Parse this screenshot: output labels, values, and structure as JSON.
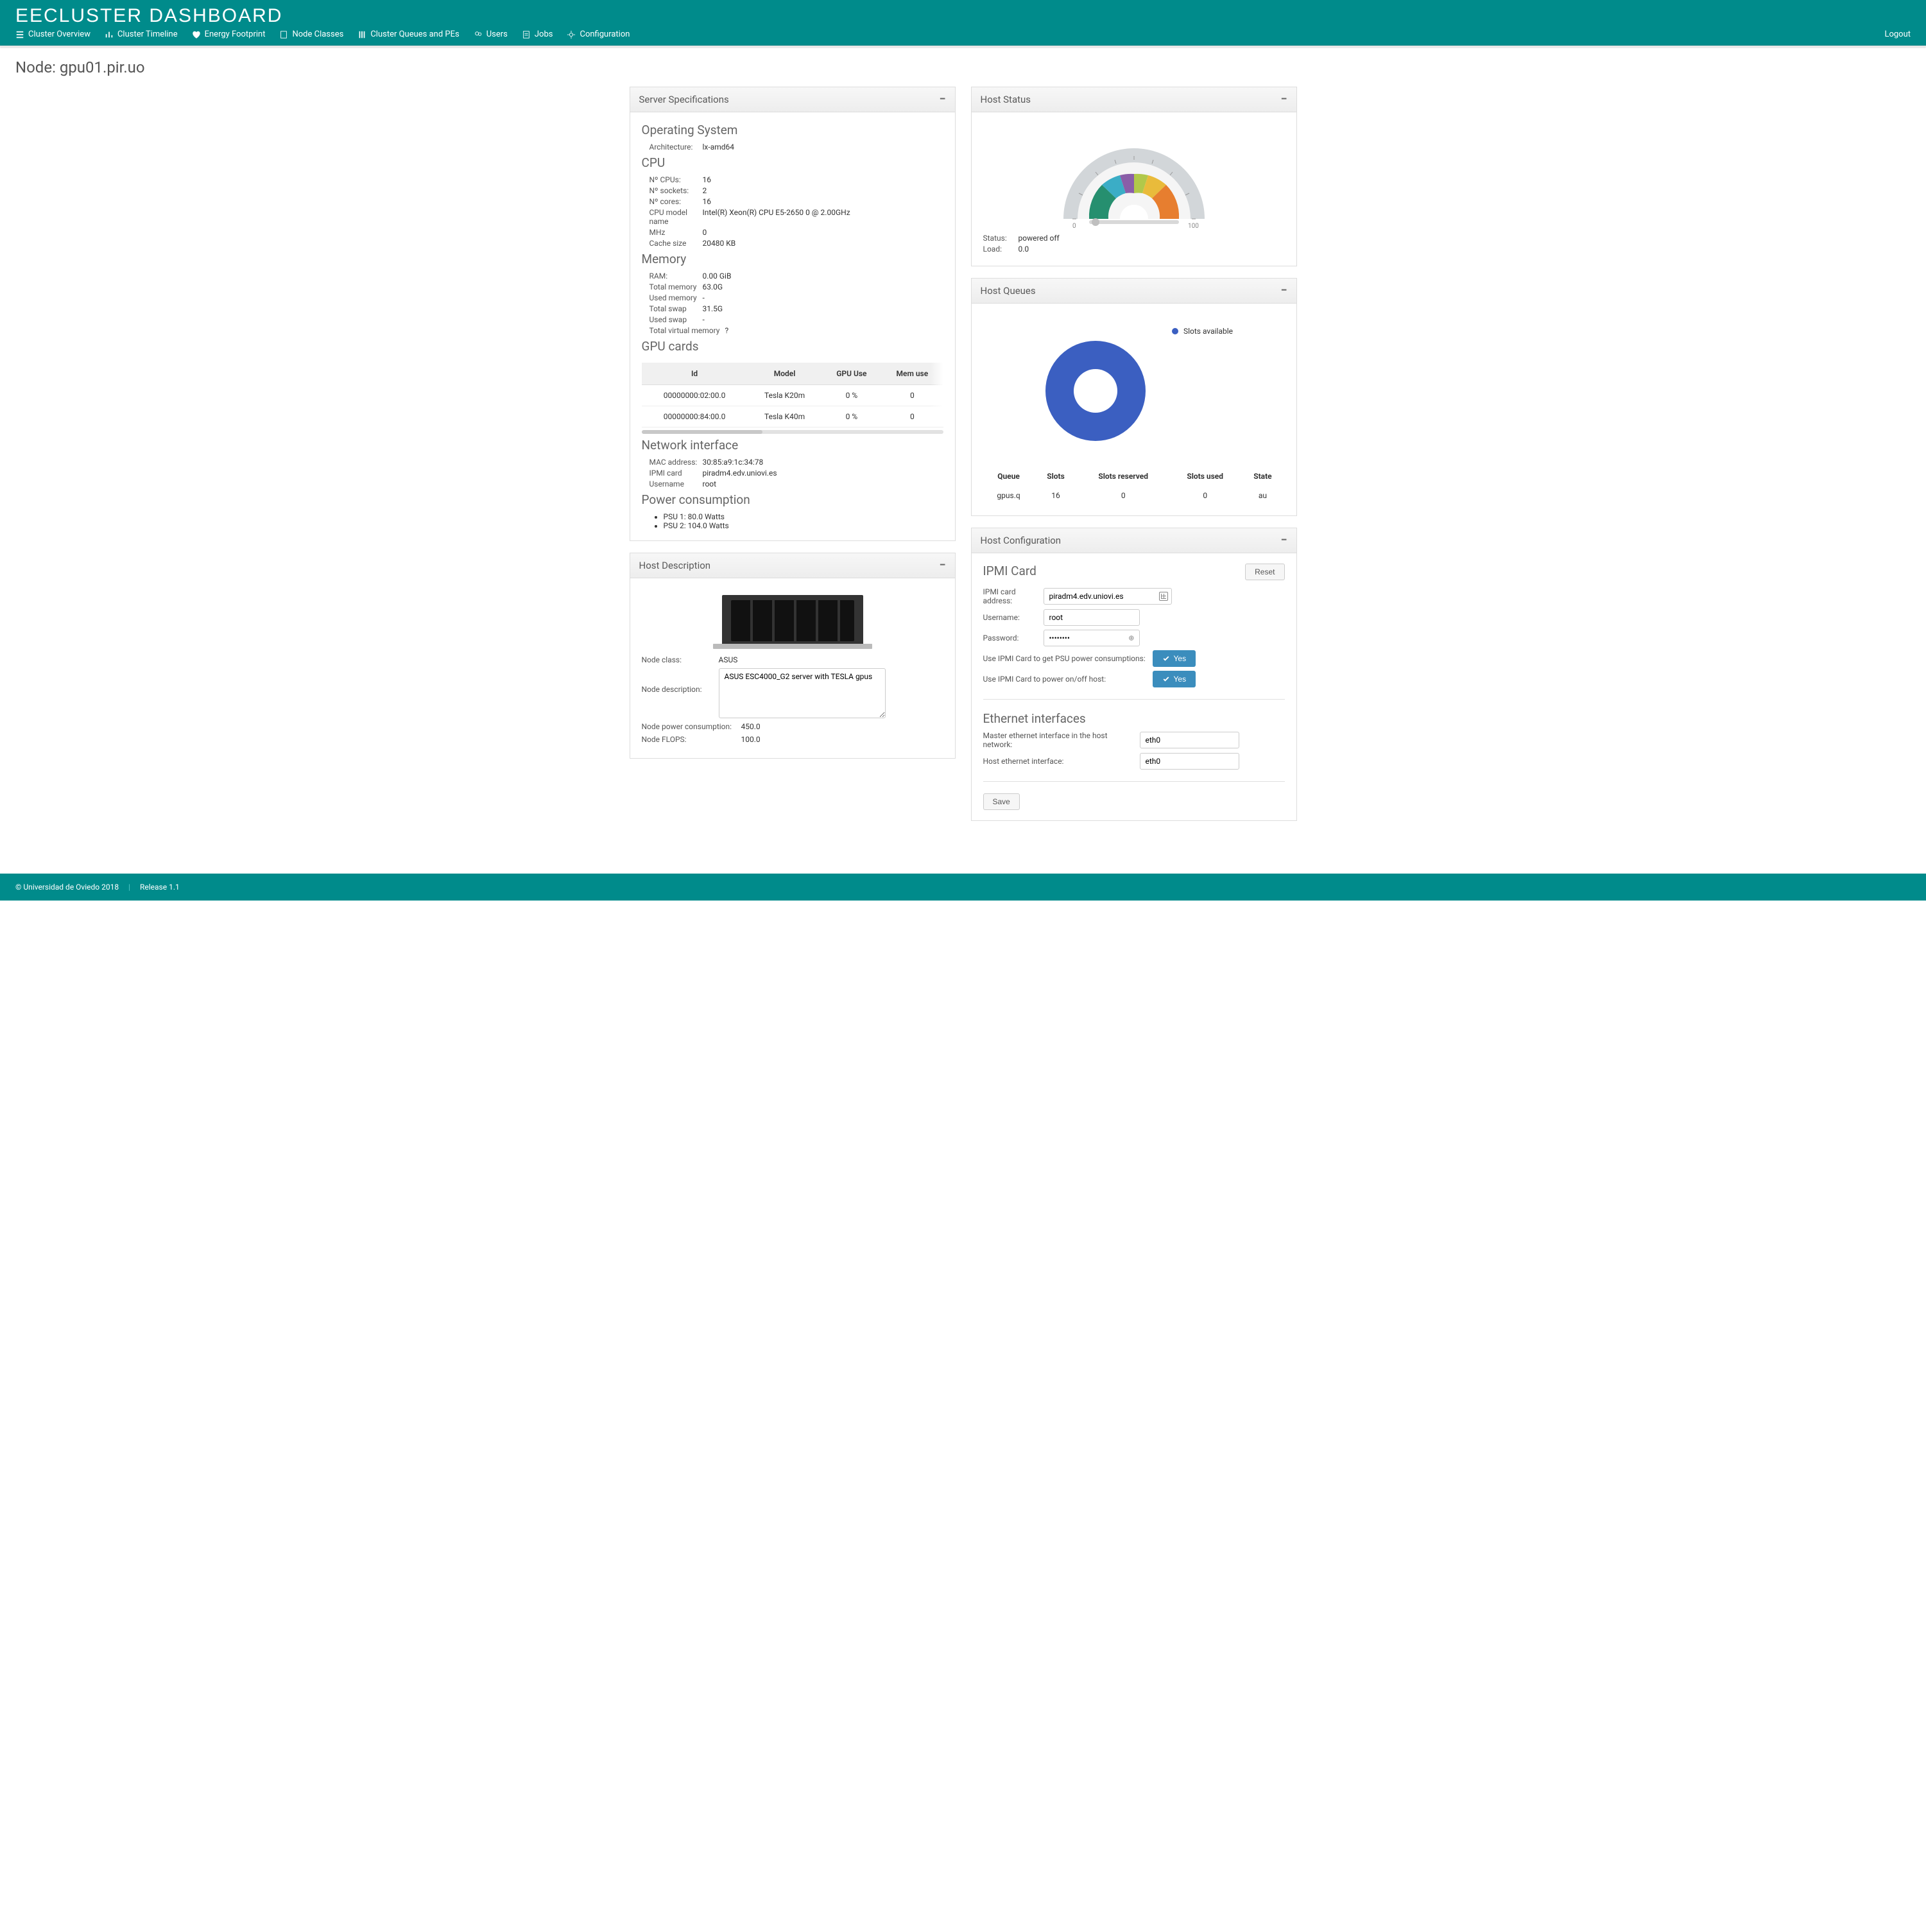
{
  "brand": "EECLUSTER DASHBOARD",
  "nav": {
    "overview": "Cluster Overview",
    "timeline": "Cluster Timeline",
    "energy": "Energy Footprint",
    "classes": "Node Classes",
    "queues": "Cluster Queues and PEs",
    "users": "Users",
    "jobs": "Jobs",
    "config": "Configuration",
    "logout": "Logout"
  },
  "page_title": "Node: gpu01.pir.uo",
  "panels": {
    "specs": "Server Specifications",
    "hostdesc": "Host Description",
    "hoststatus": "Host Status",
    "hostqueues": "Host Queues",
    "hostconfig": "Host Configuration"
  },
  "specs": {
    "os": {
      "heading": "Operating System",
      "arch_l": "Architecture:",
      "arch_v": "lx-amd64"
    },
    "cpu": {
      "heading": "CPU",
      "ncpus_l": "Nº CPUs:",
      "ncpus_v": "16",
      "nsockets_l": "Nº sockets:",
      "nsockets_v": "2",
      "ncores_l": "Nº cores:",
      "ncores_v": "16",
      "model_l": "CPU model name",
      "model_v": "Intel(R) Xeon(R) CPU E5-2650 0 @ 2.00GHz",
      "mhz_l": "MHz",
      "mhz_v": "0",
      "cache_l": "Cache size",
      "cache_v": "20480 KB"
    },
    "mem": {
      "heading": "Memory",
      "ram_l": "RAM:",
      "ram_v": "0.00 GiB",
      "totmem_l": "Total memory",
      "totmem_v": "63.0G",
      "usedmem_l": "Used memory",
      "usedmem_v": "-",
      "totswap_l": "Total swap",
      "totswap_v": "31.5G",
      "usedswap_l": "Used swap",
      "usedswap_v": "-",
      "totvirt_l": "Total virtual memory",
      "totvirt_v": "?"
    },
    "gpu": {
      "heading": "GPU cards",
      "hdr": {
        "id": "Id",
        "model": "Model",
        "gpuuse": "GPU Use",
        "memuse": "Mem use"
      },
      "rows": [
        {
          "id": "00000000:02:00.0",
          "model": "Tesla K20m",
          "gpu": "0 %",
          "mem": "0"
        },
        {
          "id": "00000000:84:00.0",
          "model": "Tesla K40m",
          "gpu": "0 %",
          "mem": "0"
        }
      ]
    },
    "net": {
      "heading": "Network interface",
      "mac_l": "MAC address:",
      "mac_v": "30:85:a9:1c:34:78",
      "ipmi_l": "IPMI card",
      "ipmi_v": "piradm4.edv.uniovi.es",
      "user_l": "Username",
      "user_v": "root"
    },
    "power": {
      "heading": "Power consumption",
      "psu1": "PSU 1: 80.0 Watts",
      "psu2": "PSU 2: 104.0 Watts"
    }
  },
  "hostdesc": {
    "class_l": "Node class:",
    "class_v": "ASUS",
    "desc_l": "Node description:",
    "desc_v": "ASUS ESC4000_G2 server with TESLA gpus",
    "power_l": "Node power consumption:",
    "power_v": "450.0",
    "flops_l": "Node FLOPS:",
    "flops_v": "100.0"
  },
  "hoststatus": {
    "status_l": "Status:",
    "status_v": "powered off",
    "load_l": "Load:",
    "load_v": "0.0",
    "gauge": {
      "min": "0",
      "max": "100"
    }
  },
  "hostqueues": {
    "legend": "Slots available",
    "hdr": {
      "queue": "Queue",
      "slots": "Slots",
      "reserved": "Slots reserved",
      "used": "Slots used",
      "state": "State"
    },
    "row": {
      "queue": "gpus.q",
      "slots": "16",
      "reserved": "0",
      "used": "0",
      "state": "au"
    }
  },
  "hostconfig": {
    "ipmi_heading": "IPMI Card",
    "reset": "Reset",
    "addr_l": "IPMI card address:",
    "addr_v": "piradm4.edv.uniovi.es",
    "user_l": "Username:",
    "user_v": "root",
    "pass_l": "Password:",
    "pass_v": "••••••••",
    "psu_toggle_l": "Use IPMI Card to get PSU power consumptions:",
    "power_toggle_l": "Use IPMI Card to power on/off host:",
    "yes": "Yes",
    "eth_heading": "Ethernet interfaces",
    "master_l": "Master ethernet interface in the host network:",
    "master_v": "eth0",
    "hosteth_l": "Host ethernet interface:",
    "hosteth_v": "eth0",
    "save": "Save"
  },
  "chart_data": [
    {
      "type": "pie",
      "title": "Host Queues — slot allocation",
      "series": [
        {
          "name": "Slots available",
          "values": [
            16
          ]
        }
      ],
      "categories": [
        "Slots available"
      ],
      "legend_position": "right"
    },
    {
      "type": "other",
      "title": "Host Status gauge",
      "xlabel": "",
      "ylabel": "",
      "ylim": [
        0,
        100
      ],
      "value": 0
    }
  ],
  "footer": {
    "copy": "© Universidad de Oviedo 2018",
    "release": "Release 1.1"
  }
}
